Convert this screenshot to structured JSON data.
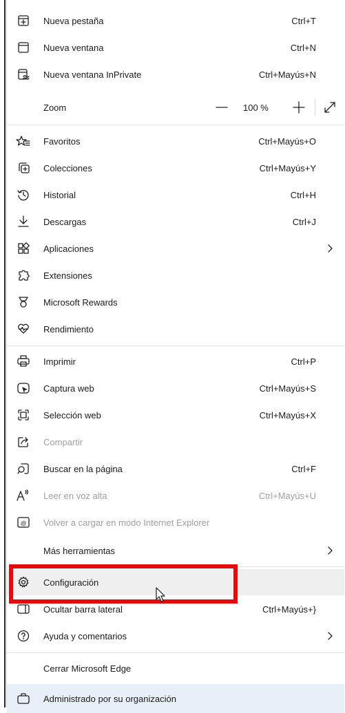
{
  "menu": {
    "new_tab": {
      "label": "Nueva pestaña",
      "shortcut": "Ctrl+T"
    },
    "new_window": {
      "label": "Nueva ventana",
      "shortcut": "Ctrl+N"
    },
    "new_inprivate": {
      "label": "Nueva ventana InPrivate",
      "shortcut": "Ctrl+Mayús+N"
    },
    "zoom": {
      "label": "Zoom",
      "value": "100 %",
      "minus_symbol": "—",
      "plus_symbol": "+"
    },
    "favorites": {
      "label": "Favoritos",
      "shortcut": "Ctrl+Mayús+O"
    },
    "collections": {
      "label": "Colecciones",
      "shortcut": "Ctrl+Mayús+Y"
    },
    "history": {
      "label": "Historial",
      "shortcut": "Ctrl+H"
    },
    "downloads": {
      "label": "Descargas",
      "shortcut": "Ctrl+J"
    },
    "apps": {
      "label": "Aplicaciones"
    },
    "extensions": {
      "label": "Extensiones"
    },
    "rewards": {
      "label": "Microsoft Rewards"
    },
    "performance": {
      "label": "Rendimiento"
    },
    "print": {
      "label": "Imprimir",
      "shortcut": "Ctrl+P"
    },
    "web_capture": {
      "label": "Captura web",
      "shortcut": "Ctrl+Mayús+S"
    },
    "web_select": {
      "label": "Selección web",
      "shortcut": "Ctrl+Mayús+X"
    },
    "share": {
      "label": "Compartir",
      "disabled": true
    },
    "find": {
      "label": "Buscar en la página",
      "shortcut": "Ctrl+F"
    },
    "read_aloud": {
      "label": "Leer en voz alta",
      "shortcut": "Ctrl+Mayús+U",
      "disabled": true
    },
    "ie_mode": {
      "label": "Volver a cargar en modo Internet Explorer",
      "disabled": true
    },
    "more_tools": {
      "label": "Más herramientas"
    },
    "settings": {
      "label": "Configuración"
    },
    "hide_sidebar": {
      "label": "Ocultar barra lateral",
      "shortcut": "Ctrl+Mayús+}"
    },
    "help": {
      "label": "Ayuda y comentarios"
    },
    "close_edge": {
      "label": "Cerrar Microsoft Edge"
    },
    "managed": {
      "label": "Administrado por su organización"
    }
  },
  "highlight_color": "#e20c0c",
  "icons": [
    "new-tab-icon",
    "new-window-icon",
    "inprivate-icon",
    "favorites-icon",
    "collections-icon",
    "history-icon",
    "download-icon",
    "apps-icon",
    "extensions-icon",
    "rewards-icon",
    "performance-icon",
    "print-icon",
    "web-capture-icon",
    "web-select-icon",
    "share-icon",
    "find-icon",
    "read-aloud-icon",
    "ie-mode-icon",
    "gear-icon",
    "help-icon",
    "briefcase-icon",
    "chevron-right-icon",
    "zoom-out-icon",
    "zoom-in-icon",
    "fullscreen-icon",
    "mouse-cursor-icon"
  ]
}
